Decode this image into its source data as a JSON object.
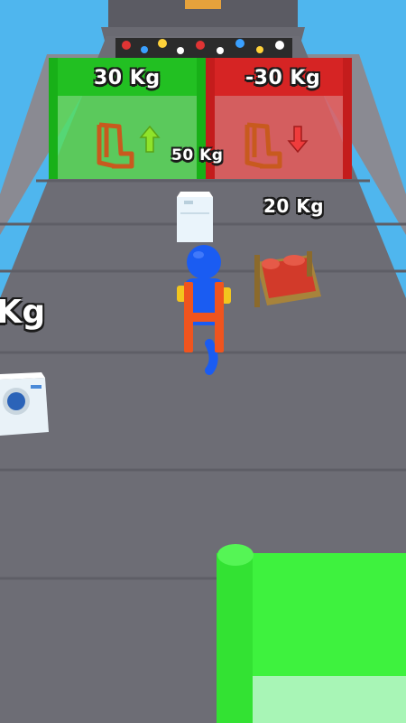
{
  "gates": {
    "positive": {
      "label": "30 Kg",
      "color": "#2ecc2e",
      "arrow": "up-arrow-icon"
    },
    "negative": {
      "label": "-30 Kg",
      "color": "#e02a2a",
      "arrow": "down-arrow-icon"
    }
  },
  "items": {
    "fridge_weight": "50 Kg",
    "bed_weight": "20 Kg",
    "washer_weight": "Kg"
  },
  "colors": {
    "sky": "#4fb6ee",
    "track": "#6d6d75",
    "player": "#1a5cf2",
    "backpack": "#f0541e",
    "platform": "#3ef23e"
  }
}
